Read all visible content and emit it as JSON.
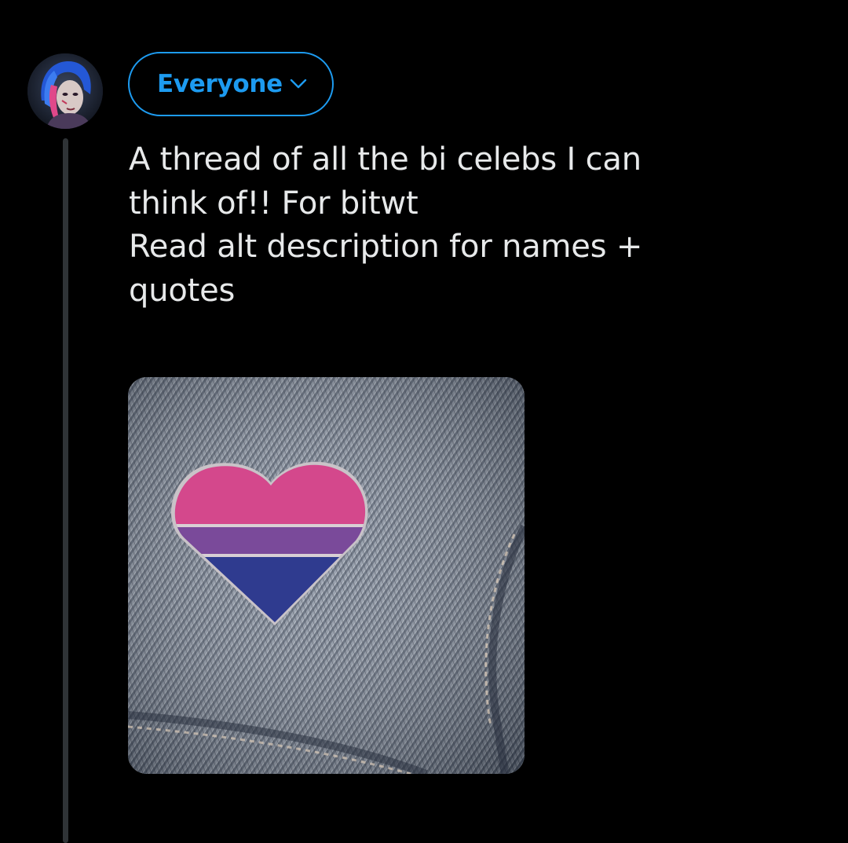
{
  "composer": {
    "avatar_icon": "user-avatar-icon",
    "audience": {
      "label": "Everyone",
      "icon": "chevron-down-icon",
      "color": "#1d9bf0"
    },
    "text_lines": [
      "A thread of all the bi celebs I can",
      "think of!! For bitwt",
      "Read alt description for names +",
      "quotes"
    ],
    "media": {
      "icon": "bisexual-pride-heart-pin-image",
      "colors": {
        "pink": "#d4488c",
        "purple": "#7a4a9a",
        "blue": "#2f3b8f"
      }
    }
  },
  "theme": {
    "background": "#000000",
    "text": "#e7e9ea",
    "thread_line": "#2f3336"
  }
}
